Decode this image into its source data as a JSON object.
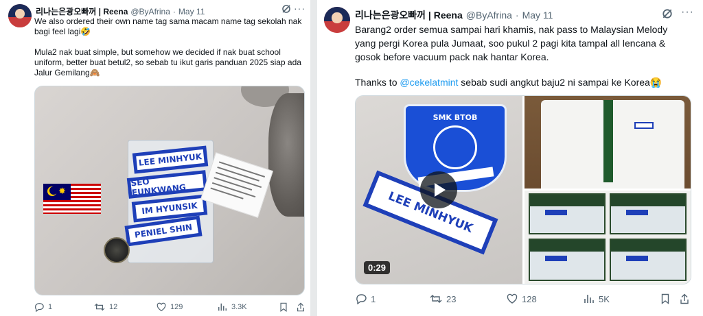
{
  "left_tweet": {
    "display_name": "리나는은광오빠꺼 | Reena",
    "handle": "@ByAfrina",
    "separator": "·",
    "date": "May 11",
    "paragraphs": [
      "We also ordered their own name tag sama macam name tag sekolah nak bagi feel lagi🤣",
      "Mula2 nak buat simple, but somehow we decided if nak buat school uniform, better buat betul2, so sebab tu ikut garis panduan 2025 siap ada Jalur Gemilang🙈"
    ],
    "photo": {
      "tags": [
        "LEE MINHYUK",
        "SEO EUNKWANG",
        "IM HYUNSIK",
        "PENIEL SHIN"
      ]
    },
    "actions": {
      "replies": "1",
      "reposts": "12",
      "likes": "129",
      "views": "3.3K"
    }
  },
  "right_tweet": {
    "display_name": "리나는은광오빠꺼 | Reena",
    "handle": "@ByAfrina",
    "separator": "·",
    "date": "May 11",
    "paragraph1": "Barang2 order semua sampai hari khamis, nak pass to Malaysian Melody yang pergi Korea pula Jumaat, soo pukul 2 pagi kita tampal all lencana & gosok before vacuum pack nak hantar Korea.",
    "paragraph2_prefix": "Thanks to ",
    "paragraph2_mention": "@cekelatmint",
    "paragraph2_suffix": " sebab sudi angkut baju2 ni sampai ke Korea😭",
    "video": {
      "badge_text": "SMK BTOB",
      "tag_text": "LEE MINHYUK",
      "duration": "0:29"
    },
    "actions": {
      "replies": "1",
      "reposts": "23",
      "likes": "128",
      "views": "5K"
    }
  },
  "colors": {
    "text_primary": "#0f1419",
    "text_secondary": "#536471",
    "link": "#1d9bf0",
    "name_tag_blue": "#1e3fb8",
    "divider": "#e7e9ea"
  },
  "icons": [
    "grok-icon",
    "more-icon",
    "reply-icon",
    "repost-icon",
    "like-icon",
    "views-icon",
    "bookmark-icon",
    "share-icon",
    "play-icon"
  ]
}
